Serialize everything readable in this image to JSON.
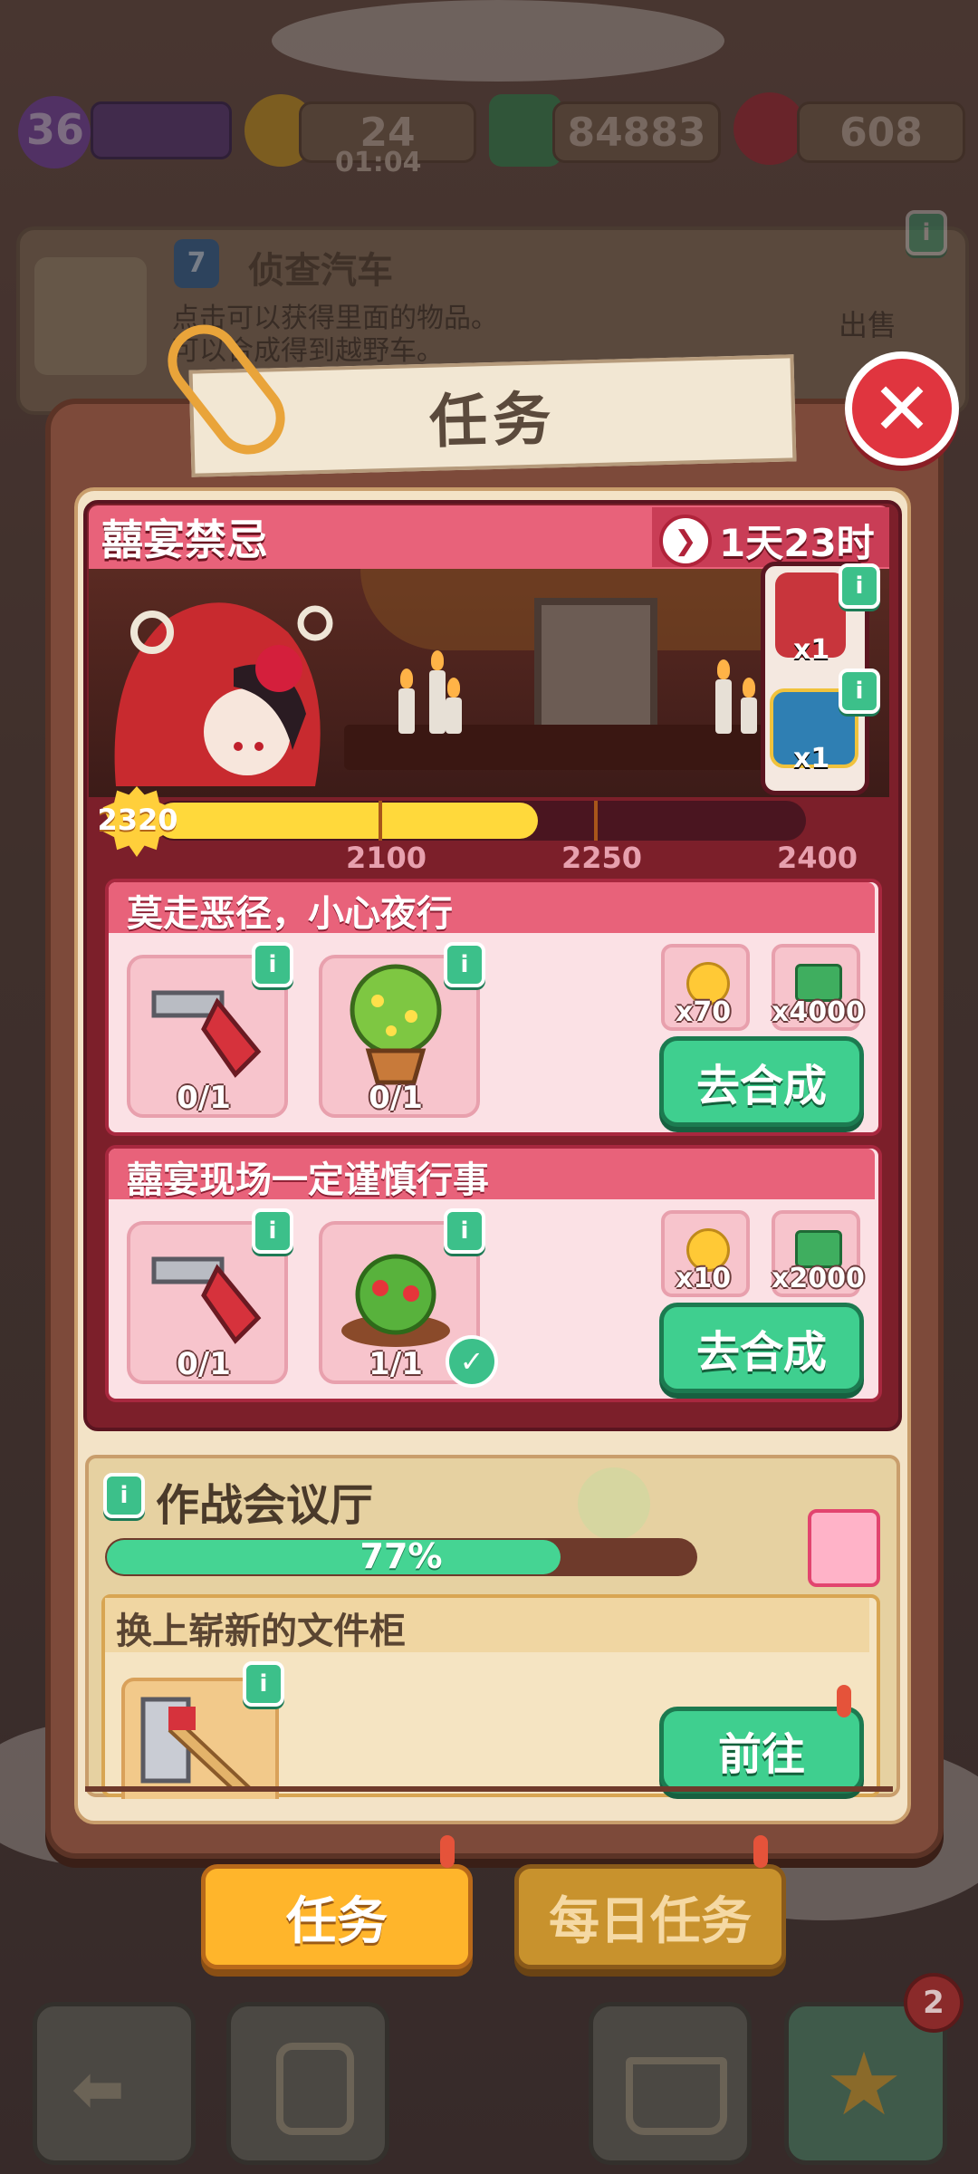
{
  "hud": {
    "level": "36",
    "energy": "24",
    "energy_timer": "01:04",
    "cash": "84883",
    "gems": "608"
  },
  "bg_card": {
    "level_badge": "7",
    "title": "侦查汽车",
    "desc_line1": "点击可以获得里面的物品。",
    "desc_line2": "可以合成得到越野车。",
    "sell_label": "出售"
  },
  "panel": {
    "title": "任务",
    "close_icon": "close-icon"
  },
  "event": {
    "title": "囍宴禁忌",
    "timer": "1天23时",
    "score": "2320",
    "progress_fraction": 0.59,
    "milestones": [
      "2100",
      "2250",
      "2400"
    ],
    "rewards": [
      {
        "icon": "bride-character-icon",
        "qty": "x1"
      },
      {
        "icon": "treasure-chest-icon",
        "qty": "x1"
      }
    ]
  },
  "tasks": [
    {
      "title": "莫走恶径，小心夜行",
      "items": [
        {
          "icon": "saw-icon",
          "count": "0/1",
          "done": false
        },
        {
          "icon": "potted-bush-icon",
          "count": "0/1",
          "done": false
        }
      ],
      "rewards": [
        {
          "icon": "gold-coin-icon",
          "qty": "x70"
        },
        {
          "icon": "cash-stack-icon",
          "qty": "x4000"
        }
      ],
      "button": "去合成"
    },
    {
      "title": "囍宴现场一定谨慎行事",
      "items": [
        {
          "icon": "saw-icon",
          "count": "0/1",
          "done": false
        },
        {
          "icon": "berry-bush-icon",
          "count": "1/1",
          "done": true
        }
      ],
      "rewards": [
        {
          "icon": "gold-coin-icon",
          "qty": "x10"
        },
        {
          "icon": "cash-stack-icon",
          "qty": "x2000"
        }
      ],
      "button": "去合成"
    }
  ],
  "war_room": {
    "title": "作战会议厅",
    "progress": "77%",
    "progress_fraction": 0.77,
    "subtask_title": "换上崭新的文件柜",
    "button": "前往"
  },
  "tabs": {
    "tasks": "任务",
    "daily": "每日任务"
  },
  "nav": {
    "badge": "2"
  },
  "colors": {
    "accent_red": "#e0353f",
    "task_pink": "#e8627a",
    "button_green": "#3fcf8f",
    "tab_orange": "#ffb52b"
  }
}
